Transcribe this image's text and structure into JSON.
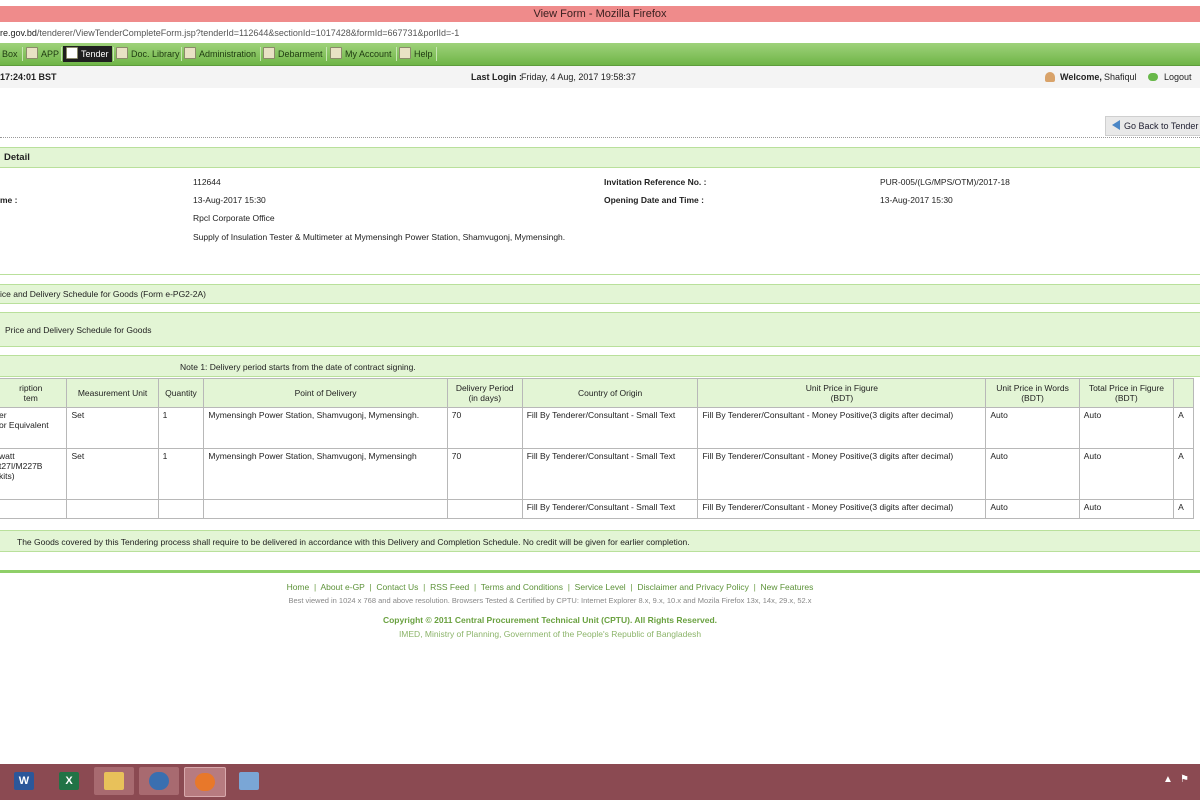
{
  "window": {
    "title": "View Form - Mozilla Firefox"
  },
  "address": {
    "host": "re.gov.bd",
    "path": "/tenderer/ViewTenderCompleteForm.jsp?tenderId=112644&sectionId=1017428&formId=667731&porlId=-1"
  },
  "nav": [
    "Box",
    "APP",
    "Tender",
    "Doc. Library",
    "Administration",
    "Debarment",
    "My Account",
    "Help"
  ],
  "status": {
    "time": "17:24:01 BST",
    "last_login_label": "Last Login :",
    "last_login_value": "Friday, 4 Aug, 2017 19:58:37",
    "welcome_label": "Welcome,",
    "user": "Shafiqul",
    "logout": "Logout"
  },
  "back_button": "Go Back to Tender",
  "detail": {
    "heading": "Detail",
    "tender_id": "112644",
    "inv_ref_label": "Invitation Reference No. :",
    "inv_ref_value": "PUR-005/(LG/MPS/OTM)/2017-18",
    "closing_label": "me :",
    "closing_value": "13-Aug-2017 15:30",
    "opening_label": "Opening Date and Time :",
    "opening_value": "13-Aug-2017 15:30",
    "office": "Rpcl Corporate Office",
    "description": "Supply of Insulation Tester & Multimeter at Mymensingh Power Station, Shamvugonj, Mymensingh."
  },
  "form": {
    "form_title": "ice and Delivery Schedule for Goods (Form e-PG2-2A)",
    "sub_title": "Price and Delivery Schedule for Goods",
    "note": "Note 1: Delivery period starts from the date of contract signing.",
    "footer_note": "The Goods covered by this Tendering process shall require to be delivered in accordance with this Delivery and Completion Schedule. No credit will be given for earlier completion."
  },
  "table": {
    "headers": [
      "ription\ntem",
      "Measurement Unit",
      "Quantity",
      "Point of Delivery",
      "Delivery Period\n(in days)",
      "Country of Origin",
      "Unit Price in Figure\n(BDT)",
      "Unit Price in Words\n(BDT)",
      "Total Price in Figure\n(BDT)",
      ""
    ],
    "rows": [
      [
        "er\n or Equivalent",
        "Set",
        "1",
        "Mymensingh Power Station, Shamvugonj, Mymensingh.",
        "70",
        "Fill By Tenderer/Consultant - Small Text",
        "Fill By Tenderer/Consultant - Money Positive(3 digits after decimal)",
        "Auto",
        "Auto",
        "A"
      ],
      [
        "watt\nt27I/M227B\n kits)",
        "Set",
        "1",
        "Mymensingh Power Station, Shamvugonj, Mymensingh",
        "70",
        "Fill By Tenderer/Consultant - Small Text",
        "Fill By Tenderer/Consultant - Money Positive(3 digits after decimal)",
        "Auto",
        "Auto",
        "A"
      ],
      [
        "",
        "",
        "",
        "",
        "",
        "Fill By Tenderer/Consultant - Small Text",
        "Fill By Tenderer/Consultant - Money Positive(3 digits after decimal)",
        "Auto",
        "Auto",
        "A"
      ]
    ]
  },
  "footer": {
    "links": [
      "Home",
      "About e-GP",
      "Contact Us",
      "RSS Feed",
      "Terms and Conditions",
      "Service Level",
      "Disclaimer and Privacy Policy",
      "New Features"
    ],
    "browser_note": "Best viewed in 1024 x 768 and above resolution. Browsers Tested & Certified by CPTU: Internet Explorer 8.x, 9.x, 10.x and Mozila Firefox 13x, 14x, 29.x, 52.x",
    "copyright": "Copyright © 2011 Central Procurement Technical Unit (CPTU). All Rights Reserved.",
    "imed": "IMED, Ministry of Planning, Government of the People's Republic of Bangladesh"
  },
  "taskbar": [
    "Word",
    "Excel",
    "File Explorer",
    "Thunderbird",
    "Firefox",
    "Notepad"
  ],
  "colors": {
    "nav_green": "#6fb547",
    "panel_green": "#e3f5d5",
    "titlebar": "#ef8b8b",
    "taskbar": "#8b4a52"
  }
}
